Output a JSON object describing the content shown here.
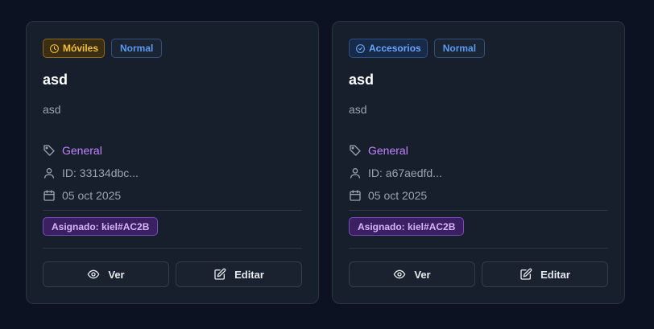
{
  "cards": [
    {
      "category_badge": {
        "label": "Móviles",
        "icon": "clock-icon",
        "color": "#f3c13a"
      },
      "priority_badge": {
        "label": "Normal"
      },
      "title": "asd",
      "description": "asd",
      "category": {
        "label": "General",
        "icon": "tag-icon"
      },
      "id": {
        "label": "ID: 33134dbc...",
        "icon": "user-icon"
      },
      "date": {
        "label": "05 oct 2025",
        "icon": "calendar-icon"
      },
      "assigned": "Asignado: kiel#AC2B",
      "actions": {
        "view_label": "Ver",
        "edit_label": "Editar"
      }
    },
    {
      "category_badge": {
        "label": "Accesorios",
        "icon": "check-circle-icon",
        "color": "#6aa6ff"
      },
      "priority_badge": {
        "label": "Normal"
      },
      "title": "asd",
      "description": "asd",
      "category": {
        "label": "General",
        "icon": "tag-icon"
      },
      "id": {
        "label": "ID: a67aedfd...",
        "icon": "user-icon"
      },
      "date": {
        "label": "05 oct 2025",
        "icon": "calendar-icon"
      },
      "assigned": "Asignado: kiel#AC2B",
      "actions": {
        "view_label": "Ver",
        "edit_label": "Editar"
      }
    }
  ]
}
